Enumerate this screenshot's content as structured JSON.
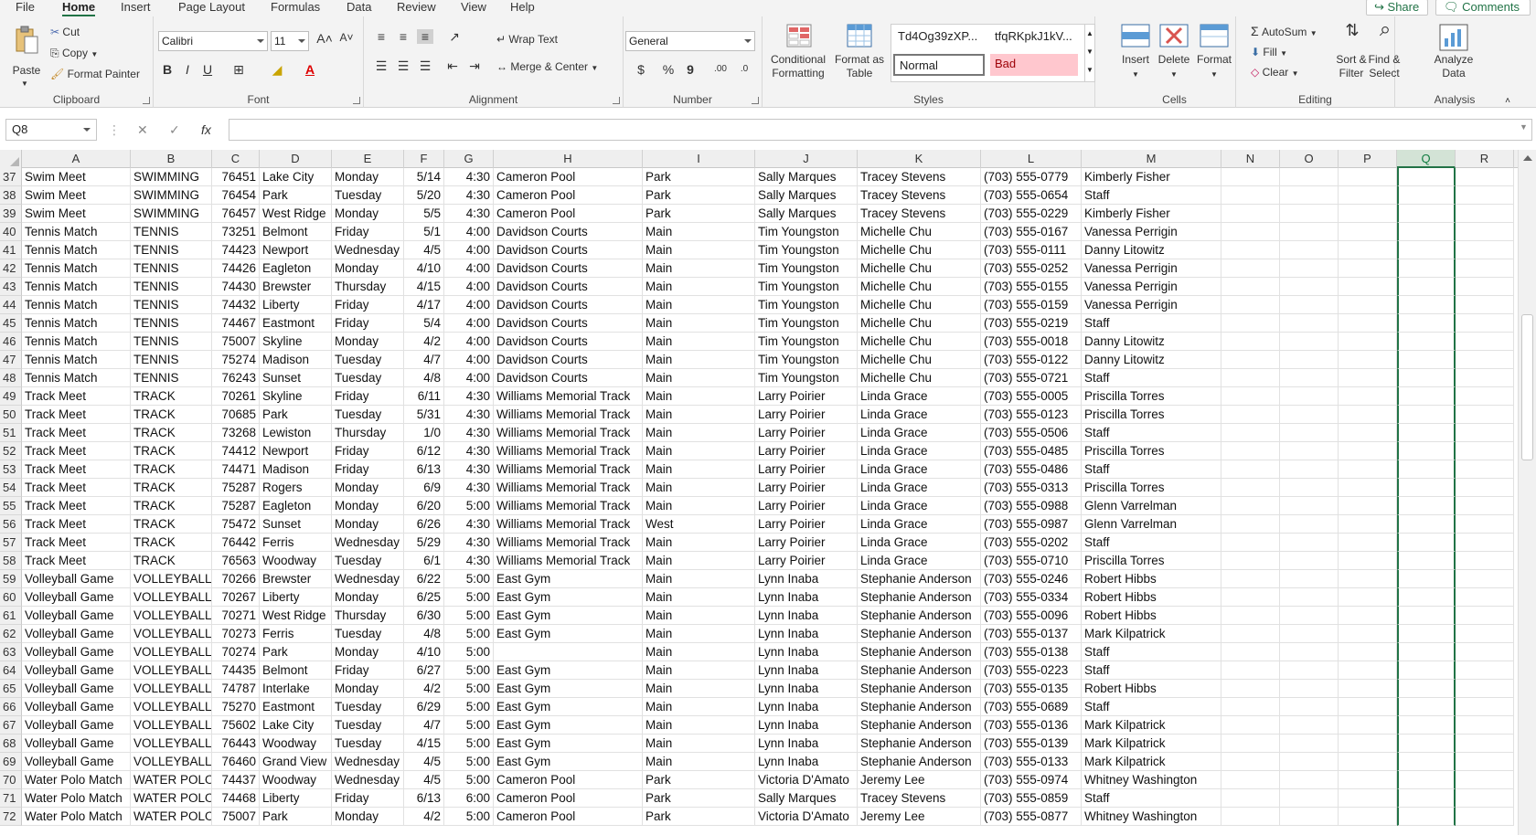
{
  "menu": {
    "tabs": [
      "File",
      "Home",
      "Insert",
      "Page Layout",
      "Formulas",
      "Data",
      "Review",
      "View",
      "Help"
    ],
    "active": "Home",
    "share": "Share",
    "comments": "Comments"
  },
  "ribbon": {
    "clipboard": {
      "label": "Clipboard",
      "paste": "Paste",
      "cut": "Cut",
      "copy": "Copy",
      "format_painter": "Format Painter"
    },
    "font": {
      "label": "Font",
      "family": "Calibri",
      "size": "11",
      "bold": "B",
      "italic": "I",
      "underline": "U"
    },
    "alignment": {
      "label": "Alignment",
      "wrap_text": "Wrap Text",
      "merge_center": "Merge & Center"
    },
    "number": {
      "label": "Number",
      "format": "General",
      "currency": "$",
      "percent": "%",
      "comma": "9",
      "inc_decimal": ".00",
      "dec_decimal": ".0"
    },
    "styles": {
      "label": "Styles",
      "conditional_formatting": "Conditional\nFormatting",
      "format_as_table": "Format as\nTable",
      "style1": "Td4Og39zXP...",
      "style2": "tfqRKpkJ1kV...",
      "normal": "Normal",
      "bad": "Bad"
    },
    "cells": {
      "label": "Cells",
      "insert": "Insert",
      "delete": "Delete",
      "format": "Format"
    },
    "editing": {
      "label": "Editing",
      "autosum": "AutoSum",
      "fill": "Fill",
      "clear": "Clear",
      "sort_filter": "Sort &\nFilter",
      "find_select": "Find &\nSelect"
    },
    "analysis": {
      "label": "Analysis",
      "analyze_data": "Analyze\nData"
    }
  },
  "formula_bar": {
    "name_box": "Q8",
    "fx": "fx",
    "value": ""
  },
  "columns": [
    "A",
    "B",
    "C",
    "D",
    "E",
    "F",
    "G",
    "H",
    "I",
    "J",
    "K",
    "L",
    "M",
    "N",
    "O",
    "P",
    "Q",
    "R"
  ],
  "selected_column": "Q",
  "rows": [
    [
      "37",
      "Swim Meet",
      "SWIMMING",
      "76451",
      "Lake City",
      "Monday",
      "5/14",
      "4:30",
      "Cameron Pool",
      "Park",
      "Sally Marques",
      "Tracey Stevens",
      "(703) 555-0779",
      "Kimberly Fisher"
    ],
    [
      "38",
      "Swim Meet",
      "SWIMMING",
      "76454",
      "Park",
      "Tuesday",
      "5/20",
      "4:30",
      "Cameron Pool",
      "Park",
      "Sally Marques",
      "Tracey Stevens",
      "(703) 555-0654",
      "Staff"
    ],
    [
      "39",
      "Swim Meet",
      "SWIMMING",
      "76457",
      "West Ridge",
      "Monday",
      "5/5",
      "4:30",
      "Cameron Pool",
      "Park",
      "Sally Marques",
      "Tracey Stevens",
      "(703) 555-0229",
      "Kimberly Fisher"
    ],
    [
      "40",
      "Tennis Match",
      "TENNIS",
      "73251",
      "Belmont",
      "Friday",
      "5/1",
      "4:00",
      "Davidson Courts",
      "Main",
      "Tim Youngston",
      "Michelle Chu",
      "(703) 555-0167",
      "Vanessa Perrigin"
    ],
    [
      "41",
      "Tennis Match",
      "TENNIS",
      "74423",
      "Newport",
      "Wednesday",
      "4/5",
      "4:00",
      "Davidson Courts",
      "Main",
      "Tim Youngston",
      "Michelle Chu",
      "(703) 555-0111",
      "Danny Litowitz"
    ],
    [
      "42",
      "Tennis Match",
      "TENNIS",
      "74426",
      "Eagleton",
      "Monday",
      "4/10",
      "4:00",
      "Davidson Courts",
      "Main",
      "Tim Youngston",
      "Michelle Chu",
      "(703) 555-0252",
      "Vanessa Perrigin"
    ],
    [
      "43",
      "Tennis Match",
      "TENNIS",
      "74430",
      "Brewster",
      "Thursday",
      "4/15",
      "4:00",
      "Davidson Courts",
      "Main",
      "Tim Youngston",
      "Michelle Chu",
      "(703) 555-0155",
      "Vanessa Perrigin"
    ],
    [
      "44",
      "Tennis Match",
      "TENNIS",
      "74432",
      "Liberty",
      "Friday",
      "4/17",
      "4:00",
      "Davidson Courts",
      "Main",
      "Tim Youngston",
      "Michelle Chu",
      "(703) 555-0159",
      "Vanessa Perrigin"
    ],
    [
      "45",
      "Tennis Match",
      "TENNIS",
      "74467",
      "Eastmont",
      "Friday",
      "5/4",
      "4:00",
      "Davidson Courts",
      "Main",
      "Tim Youngston",
      "Michelle Chu",
      "(703) 555-0219",
      "Staff"
    ],
    [
      "46",
      "Tennis Match",
      "TENNIS",
      "75007",
      "Skyline",
      "Monday",
      "4/2",
      "4:00",
      "Davidson Courts",
      "Main",
      "Tim Youngston",
      "Michelle Chu",
      "(703) 555-0018",
      "Danny Litowitz"
    ],
    [
      "47",
      "Tennis Match",
      "TENNIS",
      "75274",
      "Madison",
      "Tuesday",
      "4/7",
      "4:00",
      "Davidson Courts",
      "Main",
      "Tim Youngston",
      "Michelle Chu",
      "(703) 555-0122",
      "Danny Litowitz"
    ],
    [
      "48",
      "Tennis Match",
      "TENNIS",
      "76243",
      "Sunset",
      "Tuesday",
      "4/8",
      "4:00",
      "Davidson Courts",
      "Main",
      "Tim Youngston",
      "Michelle Chu",
      "(703) 555-0721",
      "Staff"
    ],
    [
      "49",
      "Track Meet",
      "TRACK",
      "70261",
      "Skyline",
      "Friday",
      "6/11",
      "4:30",
      "Williams Memorial Track",
      "Main",
      "Larry Poirier",
      "Linda Grace",
      "(703) 555-0005",
      "Priscilla Torres"
    ],
    [
      "50",
      "Track Meet",
      "TRACK",
      "70685",
      "Park",
      "Tuesday",
      "5/31",
      "4:30",
      "Williams Memorial Track",
      "Main",
      "Larry Poirier",
      "Linda Grace",
      "(703) 555-0123",
      "Priscilla Torres"
    ],
    [
      "51",
      "Track Meet",
      "TRACK",
      "73268",
      "Lewiston",
      "Thursday",
      "1/0",
      "4:30",
      "Williams Memorial Track",
      "Main",
      "Larry Poirier",
      "Linda Grace",
      "(703) 555-0506",
      "Staff"
    ],
    [
      "52",
      "Track Meet",
      "TRACK",
      "74412",
      "Newport",
      "Friday",
      "6/12",
      "4:30",
      "Williams Memorial Track",
      "Main",
      "Larry Poirier",
      "Linda Grace",
      "(703) 555-0485",
      "Priscilla Torres"
    ],
    [
      "53",
      "Track Meet",
      "TRACK",
      "74471",
      "Madison",
      "Friday",
      "6/13",
      "4:30",
      "Williams Memorial Track",
      "Main",
      "Larry Poirier",
      "Linda Grace",
      "(703) 555-0486",
      "Staff"
    ],
    [
      "54",
      "Track Meet",
      "TRACK",
      "75287",
      "Rogers",
      "Monday",
      "6/9",
      "4:30",
      "Williams Memorial Track",
      "Main",
      "Larry Poirier",
      "Linda Grace",
      "(703) 555-0313",
      "Priscilla Torres"
    ],
    [
      "55",
      "Track Meet",
      "TRACK",
      "75287",
      "Eagleton",
      "Monday",
      "6/20",
      "5:00",
      "Williams Memorial Track",
      "Main",
      "Larry Poirier",
      "Linda Grace",
      "(703) 555-0988",
      "Glenn Varrelman"
    ],
    [
      "56",
      "Track Meet",
      "TRACK",
      "75472",
      "Sunset",
      "Monday",
      "6/26",
      "4:30",
      "Williams Memorial Track",
      "West",
      "Larry Poirier",
      "Linda Grace",
      "(703) 555-0987",
      "Glenn Varrelman"
    ],
    [
      "57",
      "Track Meet",
      "TRACK",
      "76442",
      "Ferris",
      "Wednesday",
      "5/29",
      "4:30",
      "Williams Memorial Track",
      "Main",
      "Larry Poirier",
      "Linda Grace",
      "(703) 555-0202",
      "Staff"
    ],
    [
      "58",
      "Track Meet",
      "TRACK",
      "76563",
      "Woodway",
      "Tuesday",
      "6/1",
      "4:30",
      "Williams Memorial Track",
      "Main",
      "Larry Poirier",
      "Linda Grace",
      "(703) 555-0710",
      "Priscilla Torres"
    ],
    [
      "59",
      "Volleyball Game",
      "VOLLEYBALL",
      "70266",
      "Brewster",
      "Wednesday",
      "6/22",
      "5:00",
      "East Gym",
      "Main",
      "Lynn Inaba",
      "Stephanie Anderson",
      "(703) 555-0246",
      "Robert Hibbs"
    ],
    [
      "60",
      "Volleyball Game",
      "VOLLEYBALL",
      "70267",
      "Liberty",
      "Monday",
      "6/25",
      "5:00",
      "East Gym",
      "Main",
      "Lynn Inaba",
      "Stephanie Anderson",
      "(703) 555-0334",
      "Robert Hibbs"
    ],
    [
      "61",
      "Volleyball Game",
      "VOLLEYBALL",
      "70271",
      "West Ridge",
      "Thursday",
      "6/30",
      "5:00",
      "East Gym",
      "Main",
      "Lynn Inaba",
      "Stephanie Anderson",
      "(703) 555-0096",
      "Robert Hibbs"
    ],
    [
      "62",
      "Volleyball Game",
      "VOLLEYBALL",
      "70273",
      "Ferris",
      "Tuesday",
      "4/8",
      "5:00",
      "East Gym",
      "Main",
      "Lynn Inaba",
      "Stephanie Anderson",
      "(703) 555-0137",
      "Mark Kilpatrick"
    ],
    [
      "63",
      "Volleyball Game",
      "VOLLEYBALL",
      "70274",
      "Park",
      "Monday",
      "4/10",
      "5:00",
      "",
      "Main",
      "Lynn Inaba",
      "Stephanie Anderson",
      "(703) 555-0138",
      "Staff"
    ],
    [
      "64",
      "Volleyball Game",
      "VOLLEYBALL",
      "74435",
      "Belmont",
      "Friday",
      "6/27",
      "5:00",
      "East Gym",
      "Main",
      "Lynn Inaba",
      "Stephanie Anderson",
      "(703) 555-0223",
      "Staff"
    ],
    [
      "65",
      "Volleyball Game",
      "VOLLEYBALL",
      "74787",
      "Interlake",
      "Monday",
      "4/2",
      "5:00",
      "East Gym",
      "Main",
      "Lynn Inaba",
      "Stephanie Anderson",
      "(703) 555-0135",
      "Robert Hibbs"
    ],
    [
      "66",
      "Volleyball Game",
      "VOLLEYBALL",
      "75270",
      "Eastmont",
      "Tuesday",
      "6/29",
      "5:00",
      "East Gym",
      "Main",
      "Lynn Inaba",
      "Stephanie Anderson",
      "(703) 555-0689",
      "Staff"
    ],
    [
      "67",
      "Volleyball Game",
      "VOLLEYBALL",
      "75602",
      "Lake City",
      "Tuesday",
      "4/7",
      "5:00",
      "East Gym",
      "Main",
      "Lynn Inaba",
      "Stephanie Anderson",
      "(703) 555-0136",
      "Mark Kilpatrick"
    ],
    [
      "68",
      "Volleyball Game",
      "VOLLEYBALL",
      "76443",
      "Woodway",
      "Tuesday",
      "4/15",
      "5:00",
      "East Gym",
      "Main",
      "Lynn Inaba",
      "Stephanie Anderson",
      "(703) 555-0139",
      "Mark Kilpatrick"
    ],
    [
      "69",
      "Volleyball Game",
      "VOLLEYBALL",
      "76460",
      "Grand View",
      "Wednesday",
      "4/5",
      "5:00",
      "East Gym",
      "Main",
      "Lynn Inaba",
      "Stephanie Anderson",
      "(703) 555-0133",
      "Mark Kilpatrick"
    ],
    [
      "70",
      "Water Polo Match",
      "WATER POLO",
      "74437",
      "Woodway",
      "Wednesday",
      "4/5",
      "5:00",
      "Cameron Pool",
      "Park",
      "Victoria D'Amato",
      "Jeremy Lee",
      "(703) 555-0974",
      "Whitney Washington"
    ],
    [
      "71",
      "Water Polo Match",
      "WATER POLO",
      "74468",
      "Liberty",
      "Friday",
      "6/13",
      "6:00",
      "Cameron Pool",
      "Park",
      "Sally Marques",
      "Tracey Stevens",
      "(703) 555-0859",
      "Staff"
    ],
    [
      "72",
      "Water Polo Match",
      "WATER POLO",
      "75007",
      "Park",
      "Monday",
      "4/2",
      "5:00",
      "Cameron Pool",
      "Park",
      "Victoria D'Amato",
      "Jeremy Lee",
      "(703) 555-0877",
      "Whitney Washington"
    ]
  ],
  "colors": {
    "accent": "#217346",
    "bad_fill": "#ffc7ce",
    "bad_text": "#9c0006"
  }
}
